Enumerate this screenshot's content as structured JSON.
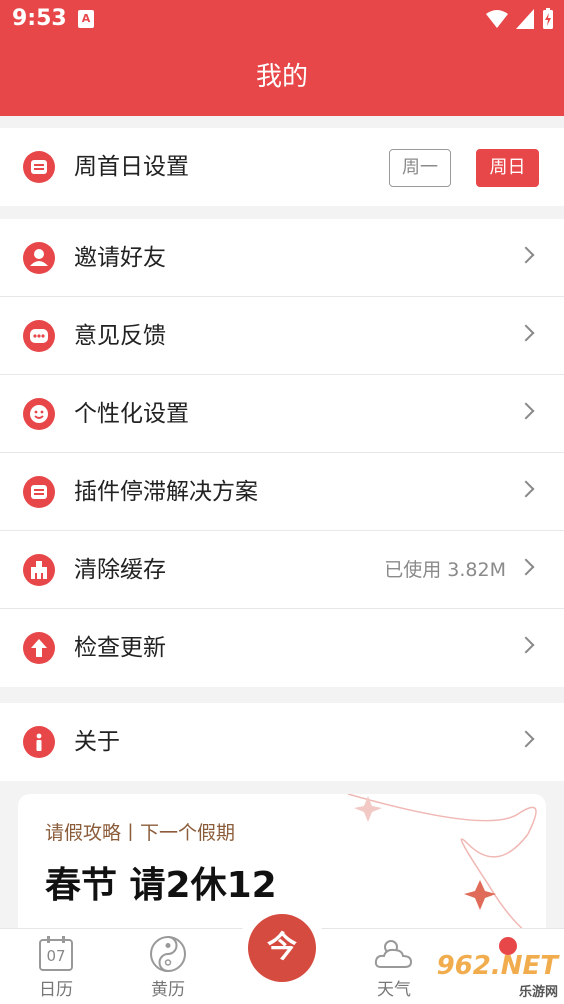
{
  "status_bar": {
    "time": "9:53",
    "notif_letter": "A"
  },
  "app_bar": {
    "title": "我的"
  },
  "week_start": {
    "label": "周首日设置",
    "options": [
      "周一",
      "周日"
    ],
    "selected": "周日"
  },
  "menu": [
    {
      "label": "邀请好友",
      "icon": "user-icon"
    },
    {
      "label": "意见反馈",
      "icon": "chat-icon"
    },
    {
      "label": "个性化设置",
      "icon": "smile-icon"
    },
    {
      "label": "插件停滞解决方案",
      "icon": "widget-icon"
    },
    {
      "label": "清除缓存",
      "icon": "broom-icon",
      "meta": "已使用 3.82M"
    },
    {
      "label": "检查更新",
      "icon": "arrow-up-icon"
    }
  ],
  "about": {
    "label": "关于",
    "icon": "info-icon"
  },
  "holiday_card": {
    "subtitle": "请假攻略丨下一个假期",
    "headline": "春节 请2休12"
  },
  "tabs": [
    {
      "label": "日历",
      "icon": "calendar-icon",
      "day": "07"
    },
    {
      "label": "黄历",
      "icon": "yinyang-icon"
    },
    {
      "label": "天气",
      "icon": "weather-icon"
    }
  ],
  "center_tab": {
    "label": "今"
  },
  "watermark": {
    "text": "962.NET",
    "sub": "乐游网"
  },
  "colors": {
    "brand": "#e8474a",
    "card_accent": "#8b5c3a"
  }
}
